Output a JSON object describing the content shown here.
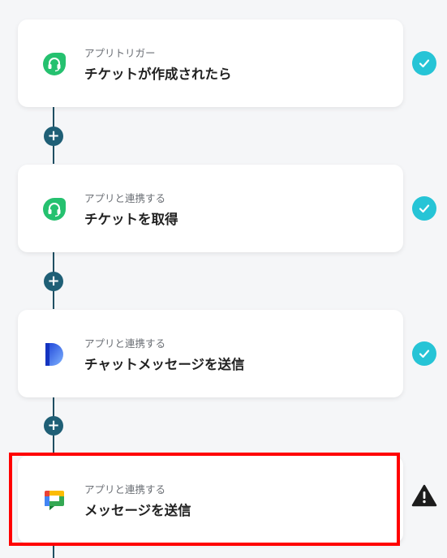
{
  "steps": [
    {
      "subtitle": "アプリトリガー",
      "title": "チケットが作成されたら",
      "icon": "freshdesk-headset-icon",
      "status": "check"
    },
    {
      "subtitle": "アプリと連携する",
      "title": "チケットを取得",
      "icon": "freshdesk-headset-icon",
      "status": "check"
    },
    {
      "subtitle": "アプリと連携する",
      "title": "チャットメッセージを送信",
      "icon": "dialpad-d-icon",
      "status": "check"
    },
    {
      "subtitle": "アプリと連携する",
      "title": "メッセージを送信",
      "icon": "google-chat-icon",
      "status": "warning"
    }
  ],
  "plus_label": "+",
  "colors": {
    "connector": "#1f4f63",
    "check": "#26c4d6",
    "highlight": "#ff0000",
    "freshdesk_green": "#25c16f"
  }
}
